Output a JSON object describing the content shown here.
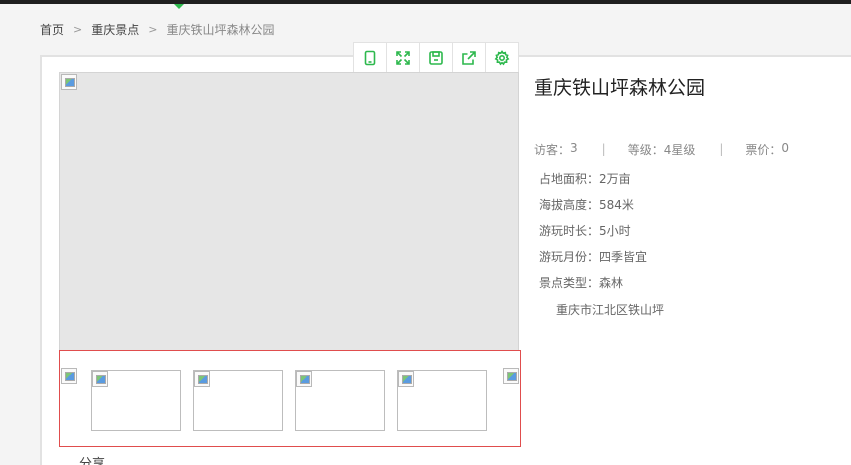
{
  "breadcrumb": {
    "home": "首页",
    "sep1": ">",
    "category": "重庆景点",
    "sep2": ">",
    "current": "重庆铁山坪森林公园"
  },
  "toolbar": {
    "buttons": [
      {
        "icon": "tablet-icon"
      },
      {
        "icon": "expand-icon"
      },
      {
        "icon": "save-icon"
      },
      {
        "icon": "share-icon"
      },
      {
        "icon": "gear-icon"
      }
    ],
    "accent_color": "#2db84d"
  },
  "gallery": {
    "thumbnail_count": 4,
    "strip_border_color": "#e04d4d"
  },
  "share_label": "分享",
  "attraction": {
    "title": "重庆铁山坪森林公园",
    "stats": {
      "visitors_label": "访客：",
      "visitors_value": "3",
      "grade_label": "等级：",
      "grade_value": "4星级",
      "price_label": "票价：",
      "price_value": "0",
      "divider": "|"
    },
    "attributes": [
      {
        "label": "占地面积：",
        "value": "2万亩"
      },
      {
        "label": "海拔高度：",
        "value": "584米"
      },
      {
        "label": "游玩时长：",
        "value": "5小时"
      },
      {
        "label": "游玩月份：",
        "value": "四季皆宜"
      },
      {
        "label": "景点类型：",
        "value": "森林"
      }
    ],
    "address": "重庆市江北区铁山坪"
  }
}
